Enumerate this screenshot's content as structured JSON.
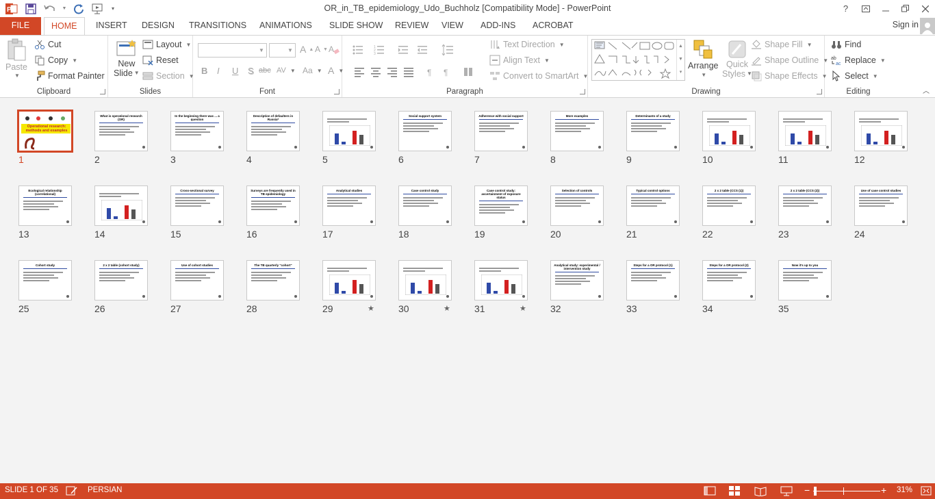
{
  "app": {
    "title": "OR_in_TB_epidemiology_Udo_Buchholz [Compatibility Mode] - PowerPoint",
    "help": "?",
    "signin": "Sign in"
  },
  "tabs": [
    "FILE",
    "HOME",
    "INSERT",
    "DESIGN",
    "TRANSITIONS",
    "ANIMATIONS",
    "SLIDE SHOW",
    "REVIEW",
    "VIEW",
    "ADD-INS",
    "ACROBAT"
  ],
  "ribbon": {
    "clipboard": {
      "label": "Clipboard",
      "paste": "Paste",
      "cut": "Cut",
      "copy": "Copy",
      "format_painter": "Format Painter"
    },
    "slides": {
      "label": "Slides",
      "new_slide_1": "New",
      "new_slide_2": "Slide",
      "layout": "Layout",
      "reset": "Reset",
      "section": "Section"
    },
    "font": {
      "label": "Font",
      "bold": "B",
      "italic": "I",
      "underline": "U",
      "shadow": "S",
      "strike": "abc",
      "spacing": "AV",
      "case": "Aa",
      "color": "A",
      "grow": "A",
      "shrink": "A"
    },
    "paragraph": {
      "label": "Paragraph",
      "text_direction": "Text Direction",
      "align_text": "Align Text",
      "smartart": "Convert to SmartArt"
    },
    "drawing": {
      "label": "Drawing",
      "arrange": "Arrange",
      "quick_1": "Quick",
      "quick_2": "Styles",
      "shape_fill": "Shape Fill",
      "shape_outline": "Shape Outline",
      "shape_effects": "Shape Effects"
    },
    "editing": {
      "label": "Editing",
      "find": "Find",
      "replace": "Replace",
      "select": "Select"
    }
  },
  "slides": [
    {
      "n": "1",
      "title": "Operational research: methods and examples",
      "selected": true
    },
    {
      "n": "2",
      "title": "What is operational research (OR)"
    },
    {
      "n": "3",
      "title": "In the beginning there was ... a question"
    },
    {
      "n": "4",
      "title": "Description of defaulters in Russia*"
    },
    {
      "n": "5",
      "title": ""
    },
    {
      "n": "6",
      "title": "Social support system"
    },
    {
      "n": "7",
      "title": "Adherence with social support"
    },
    {
      "n": "8",
      "title": "More examples"
    },
    {
      "n": "9",
      "title": "Determinants of a study"
    },
    {
      "n": "10",
      "title": ""
    },
    {
      "n": "11",
      "title": ""
    },
    {
      "n": "12",
      "title": ""
    },
    {
      "n": "13",
      "title": "Ecological relationship (correlational)"
    },
    {
      "n": "14",
      "title": ""
    },
    {
      "n": "15",
      "title": "Cross-sectional survey"
    },
    {
      "n": "16",
      "title": "Surveys are frequently used in TB epidemiology"
    },
    {
      "n": "17",
      "title": "Analytical studies"
    },
    {
      "n": "18",
      "title": "Case control study"
    },
    {
      "n": "19",
      "title": "Case control study: ascertainment of exposure status"
    },
    {
      "n": "20",
      "title": "Selection of controls"
    },
    {
      "n": "21",
      "title": "Typical control options"
    },
    {
      "n": "22",
      "title": "2 x 2 table (CCS (1))"
    },
    {
      "n": "23",
      "title": "2 x 2 table (CCS (2))"
    },
    {
      "n": "24",
      "title": "Use of case control studies"
    },
    {
      "n": "25",
      "title": "Cohort study"
    },
    {
      "n": "26",
      "title": "2 x 2 table (cohort study)"
    },
    {
      "n": "27",
      "title": "Use of cohort studies"
    },
    {
      "n": "28",
      "title": "The TB quarterly \"cohort\""
    },
    {
      "n": "29",
      "title": "",
      "star": true
    },
    {
      "n": "30",
      "title": "",
      "star": true
    },
    {
      "n": "31",
      "title": "",
      "star": true
    },
    {
      "n": "32",
      "title": "Analytical study: experimental / intervention study"
    },
    {
      "n": "33",
      "title": "Steps for a OR protocol (1)"
    },
    {
      "n": "34",
      "title": "Steps for a OR protocol (2)"
    },
    {
      "n": "35",
      "title": "Now it's up to you"
    }
  ],
  "status": {
    "slide": "SLIDE 1 OF 35",
    "language": "PERSIAN",
    "zoom": "31%"
  },
  "colors": {
    "accent": "#d24726"
  }
}
